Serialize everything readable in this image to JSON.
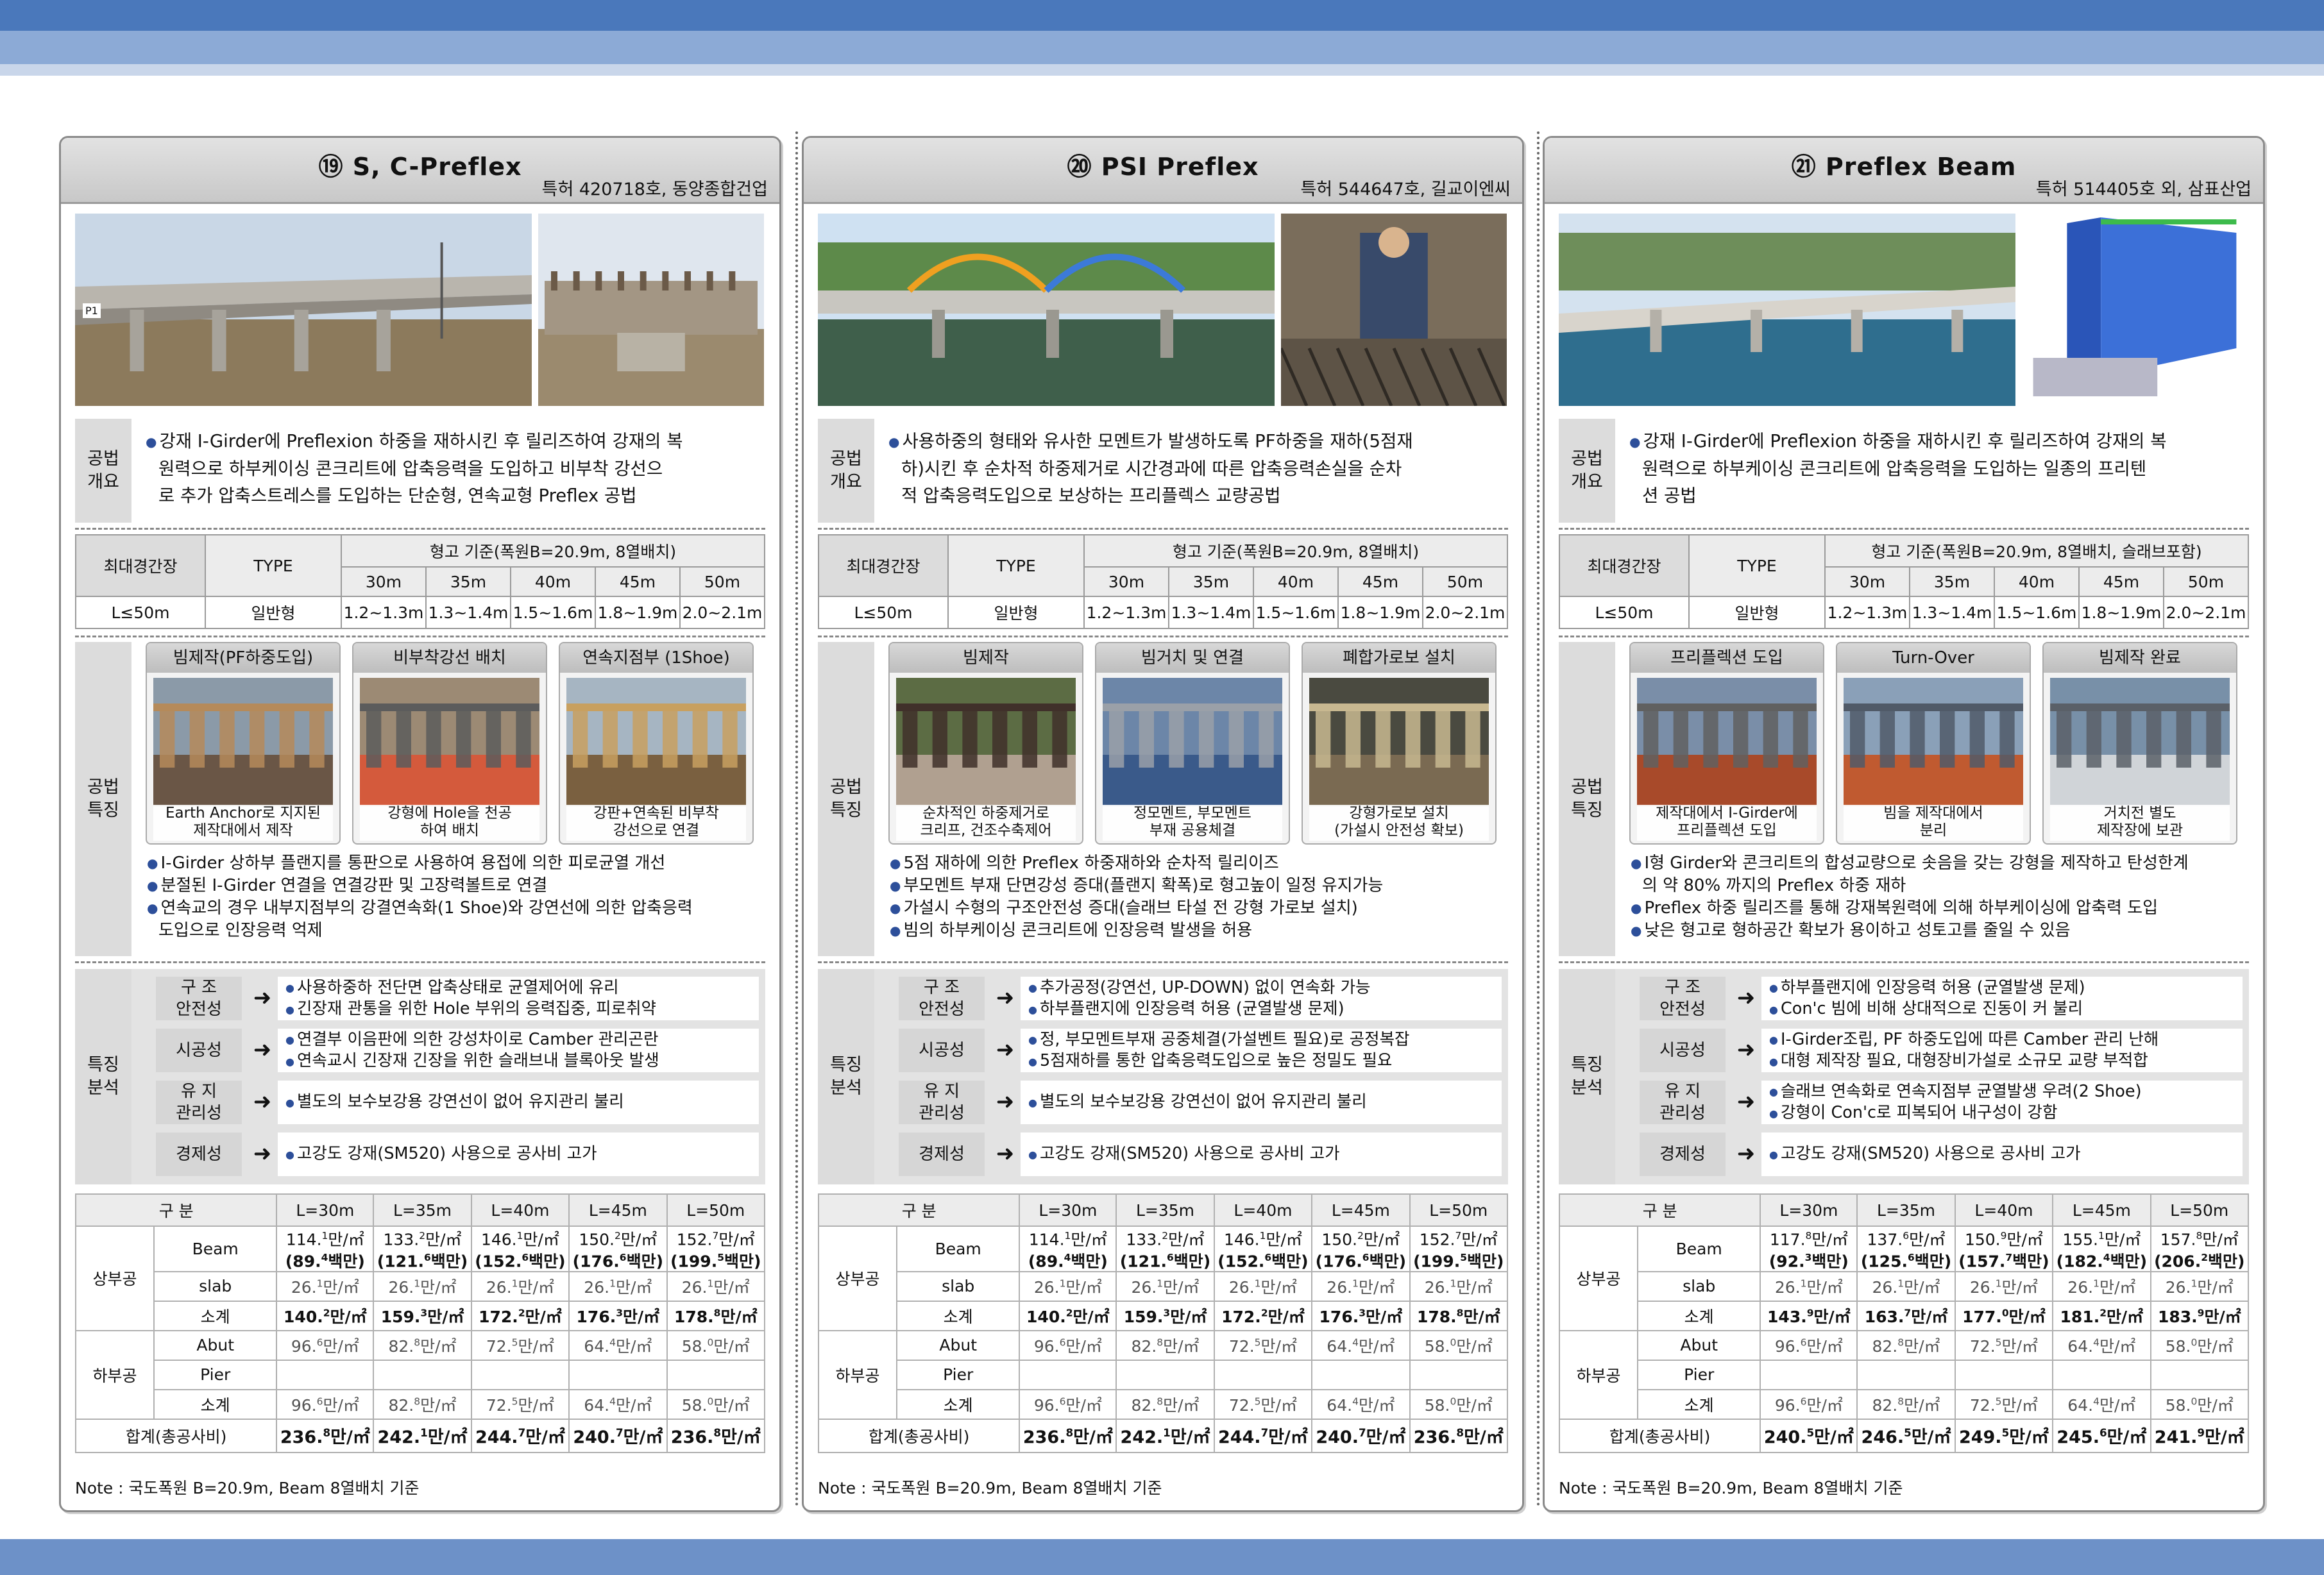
{
  "panels": [
    {
      "title": "⑲ S, C-Preflex",
      "subtitle": "특허 420718호, 동양종합건업",
      "overview_label": "공법\n개요",
      "overview": [
        "강재 I-Girder에 Preflexion 하중을 재하시킨 후 릴리즈하여 강재의 복",
        "원력으로 하부케이싱 콘크리트에 압축응력을 도입하고 비부착 강선으",
        "로 추가 압축스트레스를 도입하는 단순형, 연속교형 Preflex 공법"
      ],
      "spec": {
        "col_max": "최대경간장",
        "col_type": "TYPE",
        "col_height": "형고 기준(폭원B=20.9m, 8열배치)",
        "spans": [
          "30m",
          "35m",
          "40m",
          "45m",
          "50m"
        ],
        "max": "L≤50m",
        "type": "일반형",
        "heights": [
          "1.2~1.3m",
          "1.3~1.4m",
          "1.5~1.6m",
          "1.8~1.9m",
          "2.0~2.1m"
        ]
      },
      "feature_label": "공법\n특징",
      "tiles": [
        {
          "head": "빔제작(PF하중도입)",
          "cap": [
            "Earth Anchor로 지지된",
            "제작대에서 제작"
          ]
        },
        {
          "head": "비부착강선 배치",
          "cap": [
            "강형에 Hole을 천공",
            "하여 배치"
          ]
        },
        {
          "head": "연속지점부 (1Shoe)",
          "cap": [
            "강판+연속된 비부착",
            "강선으로 연결"
          ]
        }
      ],
      "features": [
        "I-Girder 상하부 플랜지를 통판으로 사용하여 용접에 의한 피로균열 개선",
        "분절된 I-Girder 연결을 연결강판 및 고장력볼트로 연결",
        "연속교의 경우 내부지점부의 강결연속화(1 Shoe)와 강연선에 의한 압축응력",
        "도입으로 인장응력 억제"
      ],
      "analysis_label": "특징\n분석",
      "analysis": [
        {
          "key": "구 조\n안전성",
          "lines": [
            "사용하중하 전단면 압축상태로 균열제어에 유리",
            "긴장재 관통을 위한 Hole 부위의 응력집중, 피로취약"
          ]
        },
        {
          "key": "시공성",
          "lines": [
            "연결부 이음판에 의한 강성차이로 Camber 관리곤란",
            "연속교시 긴장재 긴장을 위한 슬래브내 블록아웃 발생"
          ]
        },
        {
          "key": "유 지\n관리성",
          "lines": [
            "별도의 보수보강용 강연선이 없어 유지관리 불리"
          ]
        },
        {
          "key": "경제성",
          "lines": [
            "고강도 강재(SM520) 사용으로 공사비 고가"
          ]
        }
      ],
      "cost": {
        "head": [
          "구 분",
          "L=30m",
          "L=35m",
          "L=40m",
          "L=45m",
          "L=50m"
        ],
        "upper": "상부공",
        "lower": "하부공",
        "beam_label": "Beam",
        "beam": [
          "114.1만/㎡",
          "133.2만/㎡",
          "146.1만/㎡",
          "150.2만/㎡",
          "152.7만/㎡"
        ],
        "beam_sub": [
          "(89.4백만)",
          "(121.6백만)",
          "(152.6백만)",
          "(176.6백만)",
          "(199.5백만)"
        ],
        "slab_label": "slab",
        "slab": [
          "26.1만/㎡",
          "26.1만/㎡",
          "26.1만/㎡",
          "26.1만/㎡",
          "26.1만/㎡"
        ],
        "sub_label": "소계",
        "up_sub": [
          "140.2만/㎡",
          "159.3만/㎡",
          "172.2만/㎡",
          "176.3만/㎡",
          "178.8만/㎡"
        ],
        "abut_label": "Abut",
        "abut": [
          "96.6만/㎡",
          "82.8만/㎡",
          "72.5만/㎡",
          "64.4만/㎡",
          "58.0만/㎡"
        ],
        "pier_label": "Pier",
        "low_sub": [
          "96.6만/㎡",
          "82.8만/㎡",
          "72.5만/㎡",
          "64.4만/㎡",
          "58.0만/㎡"
        ],
        "total_label": "합계(총공사비)",
        "total": [
          "236.8만/㎡",
          "242.1만/㎡",
          "244.7만/㎡",
          "240.7만/㎡",
          "236.8만/㎡"
        ]
      },
      "note": "Note : 국도폭원 B=20.9m, Beam 8열배치 기준"
    },
    {
      "title": "⑳ PSI Preflex",
      "subtitle": "특허 544647호, 길교이엔씨",
      "overview_label": "공법\n개요",
      "overview": [
        "사용하중의 형태와 유사한 모멘트가 발생하도록 PF하중을 재하(5점재",
        "하)시킨 후 순차적 하중제거로 시간경과에 따른 압축응력손실을 순차",
        "적 압축응력도입으로 보상하는 프리플렉스 교량공법"
      ],
      "spec": {
        "col_max": "최대경간장",
        "col_type": "TYPE",
        "col_height": "형고 기준(폭원B=20.9m, 8열배치)",
        "spans": [
          "30m",
          "35m",
          "40m",
          "45m",
          "50m"
        ],
        "max": "L≤50m",
        "type": "일반형",
        "heights": [
          "1.2~1.3m",
          "1.3~1.4m",
          "1.5~1.6m",
          "1.8~1.9m",
          "2.0~2.1m"
        ]
      },
      "feature_label": "공법\n특징",
      "tiles": [
        {
          "head": "빔제작",
          "cap": [
            "순차적인 하중제거로",
            "크리프, 건조수축제어"
          ]
        },
        {
          "head": "빔거치 및 연결",
          "cap": [
            "정모멘트, 부모멘트",
            "부재 공용체결"
          ]
        },
        {
          "head": "폐합가로보 설치",
          "cap": [
            "강형가로보 설치",
            "(가설시 안전성 확보)"
          ]
        }
      ],
      "features": [
        "5점 재하에 의한 Preflex 하중재하와 순차적 릴리이즈",
        "부모멘트 부재 단면강성 증대(플랜지 확폭)로 형고높이 일정 유지가능",
        "가설시 수형의 구조안전성 증대(슬래브 타설 전 강형 가로보 설치)",
        "빔의 하부케이싱 콘크리트에 인장응력 발생을 허용"
      ],
      "analysis_label": "특징\n분석",
      "analysis": [
        {
          "key": "구 조\n안전성",
          "lines": [
            "추가공정(강연선, UP-DOWN) 없이 연속화 가능",
            "하부플랜지에 인장응력 허용 (균열발생 문제)"
          ]
        },
        {
          "key": "시공성",
          "lines": [
            "정, 부모멘트부재 공중체결(가설벤트 필요)로 공정복잡",
            "5점재하를 통한 압축응력도입으로 높은 정밀도 필요"
          ]
        },
        {
          "key": "유 지\n관리성",
          "lines": [
            "별도의 보수보강용 강연선이 없어 유지관리 불리"
          ]
        },
        {
          "key": "경제성",
          "lines": [
            "고강도 강재(SM520) 사용으로 공사비 고가"
          ]
        }
      ],
      "cost": {
        "head": [
          "구 분",
          "L=30m",
          "L=35m",
          "L=40m",
          "L=45m",
          "L=50m"
        ],
        "upper": "상부공",
        "lower": "하부공",
        "beam_label": "Beam",
        "beam": [
          "114.1만/㎡",
          "133.2만/㎡",
          "146.1만/㎡",
          "150.2만/㎡",
          "152.7만/㎡"
        ],
        "beam_sub": [
          "(89.4백만)",
          "(121.6백만)",
          "(152.6백만)",
          "(176.6백만)",
          "(199.5백만)"
        ],
        "slab_label": "slab",
        "slab": [
          "26.1만/㎡",
          "26.1만/㎡",
          "26.1만/㎡",
          "26.1만/㎡",
          "26.1만/㎡"
        ],
        "sub_label": "소계",
        "up_sub": [
          "140.2만/㎡",
          "159.3만/㎡",
          "172.2만/㎡",
          "176.3만/㎡",
          "178.8만/㎡"
        ],
        "abut_label": "Abut",
        "abut": [
          "96.6만/㎡",
          "82.8만/㎡",
          "72.5만/㎡",
          "64.4만/㎡",
          "58.0만/㎡"
        ],
        "pier_label": "Pier",
        "low_sub": [
          "96.6만/㎡",
          "82.8만/㎡",
          "72.5만/㎡",
          "64.4만/㎡",
          "58.0만/㎡"
        ],
        "total_label": "합계(총공사비)",
        "total": [
          "236.8만/㎡",
          "242.1만/㎡",
          "244.7만/㎡",
          "240.7만/㎡",
          "236.8만/㎡"
        ]
      },
      "note": "Note : 국도폭원 B=20.9m, Beam 8열배치 기준"
    },
    {
      "title": "㉑ Preflex Beam",
      "subtitle": "특허 514405호 외, 삼표산업",
      "overview_label": "공법\n개요",
      "overview": [
        "강재 I-Girder에 Preflexion 하중을 재하시킨 후 릴리즈하여 강재의 복",
        "원력으로 하부케이싱 콘크리트에 압축응력을 도입하는 일종의 프리텐",
        "션 공법"
      ],
      "spec": {
        "col_max": "최대경간장",
        "col_type": "TYPE",
        "col_height": "형고 기준(폭원B=20.9m, 8열배치, 슬래브포함)",
        "spans": [
          "30m",
          "35m",
          "40m",
          "45m",
          "50m"
        ],
        "max": "L≤50m",
        "type": "일반형",
        "heights": [
          "1.2~1.3m",
          "1.3~1.4m",
          "1.5~1.6m",
          "1.8~1.9m",
          "2.0~2.1m"
        ]
      },
      "feature_label": "공법\n특징",
      "tiles": [
        {
          "head": "프리플렉션 도입",
          "cap": [
            "제작대에서 I-Girder에",
            "프리플렉션 도입"
          ]
        },
        {
          "head": "Turn-Over",
          "cap": [
            "빔을 제작대에서",
            "분리"
          ]
        },
        {
          "head": "빔제작 완료",
          "cap": [
            "거치전 별도",
            "제작장에 보관"
          ]
        }
      ],
      "features": [
        "I형 Girder와 콘크리트의 합성교량으로 솟음을 갖는 강형을 제작하고  탄성한계",
        "의 약 80% 까지의 Preflex 하중 재하",
        "Preflex 하중 릴리즈를 통해 강재복원력에 의해 하부케이싱에 압축력 도입",
        "낮은 형고로 형하공간 확보가 용이하고 성토고를 줄일 수 있음"
      ],
      "analysis_label": "특징\n분석",
      "analysis": [
        {
          "key": "구 조\n안전성",
          "lines": [
            "하부플랜지에 인장응력 허용 (균열발생 문제)",
            "Con'c 빔에 비해 상대적으로 진동이 커 불리"
          ]
        },
        {
          "key": "시공성",
          "lines": [
            "I-Girder조립, PF 하중도입에 따른 Camber 관리 난해",
            "대형 제작장 필요, 대형장비가설로 소규모 교량 부적합"
          ]
        },
        {
          "key": "유 지\n관리성",
          "lines": [
            "슬래브 연속화로 연속지점부 균열발생 우려(2 Shoe)",
            "강형이 Con'c로 피복되어 내구성이 강함"
          ]
        },
        {
          "key": "경제성",
          "lines": [
            "고강도 강재(SM520) 사용으로 공사비 고가"
          ]
        }
      ],
      "cost": {
        "head": [
          "구 분",
          "L=30m",
          "L=35m",
          "L=40m",
          "L=45m",
          "L=50m"
        ],
        "upper": "상부공",
        "lower": "하부공",
        "beam_label": "Beam",
        "beam": [
          "117.8만/㎡",
          "137.6만/㎡",
          "150.9만/㎡",
          "155.1만/㎡",
          "157.8만/㎡"
        ],
        "beam_sub": [
          "(92.3백만)",
          "(125.6백만)",
          "(157.7백만)",
          "(182.4백만)",
          "(206.2백만)"
        ],
        "slab_label": "slab",
        "slab": [
          "26.1만/㎡",
          "26.1만/㎡",
          "26.1만/㎡",
          "26.1만/㎡",
          "26.1만/㎡"
        ],
        "sub_label": "소계",
        "up_sub": [
          "143.9만/㎡",
          "163.7만/㎡",
          "177.0만/㎡",
          "181.2만/㎡",
          "183.9만/㎡"
        ],
        "abut_label": "Abut",
        "abut": [
          "96.6만/㎡",
          "82.8만/㎡",
          "72.5만/㎡",
          "64.4만/㎡",
          "58.0만/㎡"
        ],
        "pier_label": "Pier",
        "low_sub": [
          "96.6만/㎡",
          "82.8만/㎡",
          "72.5만/㎡",
          "64.4만/㎡",
          "58.0만/㎡"
        ],
        "total_label": "합계(총공사비)",
        "total": [
          "240.5만/㎡",
          "246.5만/㎡",
          "249.5만/㎡",
          "245.6만/㎡",
          "241.9만/㎡"
        ]
      },
      "note": "Note : 국도폭원 B=20.9m, Beam 8열배치 기준"
    }
  ],
  "photo_label_p1": "P1",
  "arrow": "➜",
  "bullet": "●",
  "colors": {
    "band_dark": "#4a78bb",
    "band_light": "#8caad6",
    "bullet": "#2d4f9a"
  }
}
